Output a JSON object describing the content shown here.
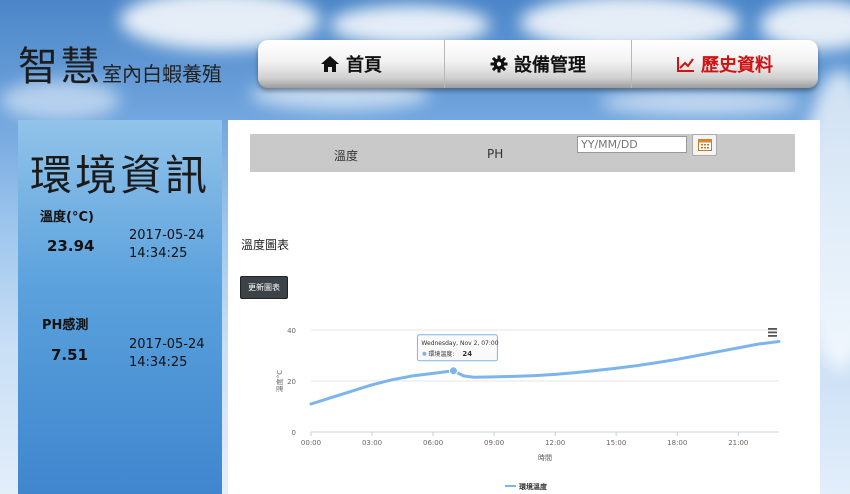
{
  "header": {
    "logo_big": "智慧",
    "logo_small": "室內白蝦養殖"
  },
  "nav": {
    "home": "首頁",
    "device": "設備管理",
    "history": "歷史資料"
  },
  "sidebar": {
    "title": "環境資訊",
    "temp_label": "溫度(°C)",
    "temp_value": "23.94",
    "temp_date": "2017-05-24",
    "temp_time": "14:34:25",
    "ph_label": "PH感測",
    "ph_value": "7.51",
    "ph_date": "2017-05-24",
    "ph_time": "14:34:25"
  },
  "main": {
    "tab_temp": "溫度",
    "tab_ph": "PH",
    "date_placeholder": "YY/MM/DD",
    "section_title": "溫度圖表",
    "refresh_label": "更新圖表"
  },
  "colors": {
    "series": "#7cb5ec",
    "nav_active": "#d01212"
  },
  "chart_data": {
    "type": "line",
    "title": "",
    "xlabel": "時間",
    "ylabel": "溫度°C",
    "x_ticks": [
      "00:00",
      "03:00",
      "06:00",
      "09:00",
      "12:00",
      "15:00",
      "18:00",
      "21:00"
    ],
    "y_ticks": [
      "0",
      "20",
      "40"
    ],
    "ylim": [
      0,
      40
    ],
    "xlim": [
      0,
      23
    ],
    "series": [
      {
        "name": "環境溫度",
        "x": [
          0,
          1,
          2,
          3,
          4,
          5,
          6,
          7,
          7.5,
          8,
          9,
          10,
          11,
          12,
          13,
          14,
          15,
          16,
          17,
          18,
          19,
          20,
          21,
          22,
          23
        ],
        "y": [
          11,
          13.5,
          16,
          18.5,
          20.5,
          22,
          23,
          24,
          22,
          21.5,
          21.6,
          21.8,
          22.1,
          22.6,
          23.3,
          24.1,
          25,
          26,
          27.2,
          28.5,
          30,
          31.5,
          33,
          34.5,
          35.5
        ]
      }
    ],
    "tooltip": {
      "header": "Wednesday, Nov 2, 07:00",
      "series_label": "環境溫度:",
      "value": "24"
    },
    "grid": true,
    "legend": "bottom-center"
  }
}
